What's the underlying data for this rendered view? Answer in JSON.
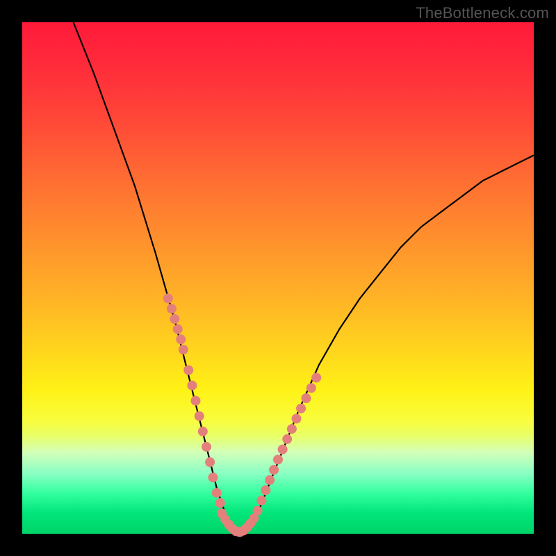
{
  "watermark": "TheBottleneck.com",
  "colors": {
    "frame": "#000000",
    "curve": "#000000",
    "dot": "#e4807b",
    "gradient_stops": [
      "#ff1a3a",
      "#ff6b33",
      "#ffd51d",
      "#fff216",
      "#d4ffb8",
      "#35ffa0",
      "#00d468"
    ]
  },
  "chart_data": {
    "type": "line",
    "title": "",
    "xlabel": "",
    "ylabel": "",
    "xlim": [
      0,
      100
    ],
    "ylim": [
      0,
      100
    ],
    "note": "V-shaped bottleneck curve. x is an unlabeled horizontal parameter; y is an unlabeled vertical percentage. Minimum (y≈0) around x≈39–44. Values estimated from pixel positions since no axis ticks are shown.",
    "series": [
      {
        "name": "curve",
        "x": [
          10,
          14,
          18,
          22,
          26,
          28,
          30,
          32,
          34,
          36,
          38,
          40,
          42,
          44,
          46,
          48,
          50,
          54,
          58,
          62,
          66,
          70,
          74,
          78,
          82,
          86,
          90,
          94,
          98,
          100
        ],
        "y": [
          100,
          90,
          79,
          68,
          55,
          48,
          41,
          33,
          25,
          17,
          9,
          3,
          0,
          1,
          4,
          9,
          14,
          24,
          33,
          40,
          46,
          51,
          56,
          60,
          63,
          66,
          69,
          71,
          73,
          74
        ]
      }
    ],
    "dot_clusters": [
      {
        "name": "left-arm-dots",
        "points": [
          [
            28.5,
            46
          ],
          [
            29.2,
            44
          ],
          [
            29.8,
            42
          ],
          [
            30.4,
            40
          ],
          [
            31.0,
            38
          ],
          [
            31.5,
            36
          ],
          [
            32.5,
            32
          ],
          [
            33.2,
            29
          ],
          [
            33.9,
            26
          ],
          [
            34.6,
            23
          ],
          [
            35.3,
            20
          ],
          [
            36.0,
            17
          ],
          [
            36.7,
            14
          ],
          [
            37.3,
            11
          ],
          [
            38.0,
            8
          ],
          [
            38.7,
            6
          ]
        ]
      },
      {
        "name": "valley-dots",
        "points": [
          [
            39.0,
            4
          ],
          [
            39.7,
            2.8
          ],
          [
            40.4,
            1.8
          ],
          [
            41.1,
            1.0
          ],
          [
            41.8,
            0.5
          ],
          [
            42.5,
            0.3
          ],
          [
            43.2,
            0.6
          ],
          [
            43.9,
            1.2
          ],
          [
            44.6,
            2.0
          ],
          [
            45.3,
            3.0
          ]
        ]
      },
      {
        "name": "right-arm-dots",
        "points": [
          [
            46.0,
            4.5
          ],
          [
            46.8,
            6.5
          ],
          [
            47.6,
            8.5
          ],
          [
            48.4,
            10.5
          ],
          [
            49.2,
            12.5
          ],
          [
            50.0,
            14.5
          ],
          [
            50.9,
            16.5
          ],
          [
            51.8,
            18.5
          ],
          [
            52.7,
            20.5
          ],
          [
            53.6,
            22.5
          ],
          [
            54.5,
            24.5
          ],
          [
            55.5,
            26.5
          ],
          [
            56.5,
            28.5
          ],
          [
            57.5,
            30.5
          ]
        ]
      }
    ]
  }
}
